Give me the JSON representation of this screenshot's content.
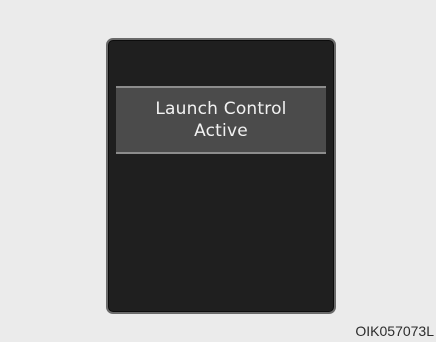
{
  "display": {
    "message_line1": "Launch Control",
    "message_line2": "Active"
  },
  "figure_code": "OIK057073L",
  "colors": {
    "page_background": "#ebebeb",
    "display_background": "#1f1f1f",
    "banner_background": "#4b4b4b",
    "text": "#f2f2f2"
  }
}
